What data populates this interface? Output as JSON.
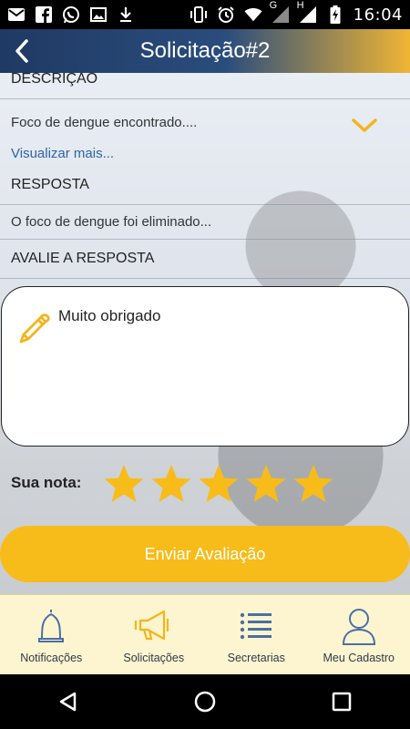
{
  "status_bar": {
    "time": "16:04",
    "left_icons": [
      "mail-icon",
      "facebook-icon",
      "whatsapp-icon",
      "image-icon",
      "download-icon"
    ],
    "right_icons": [
      "vibrate-icon",
      "alarm-icon",
      "wifi-icon",
      "g-signal-icon",
      "h-signal-icon",
      "battery-icon"
    ],
    "network_g": "G",
    "network_h": "H"
  },
  "app_bar": {
    "title": "Solicitação#2"
  },
  "sections": {
    "descricao_label": "DESCRIÇÃO",
    "descricao_text": "Foco de dengue encontrado....",
    "visualizar_mais": "Visualizar mais...",
    "resposta_label": "RESPOSTA",
    "resposta_text": "O foco de dengue foi eliminado...",
    "avalie_label": "AVALIE A RESPOSTA"
  },
  "review": {
    "comment_value": "Muito obrigado",
    "rating_label": "Sua nota:",
    "rating": 5,
    "max_rating": 5,
    "submit_label": "Enviar Avaliação"
  },
  "bottom_nav": {
    "items": [
      {
        "label": "Notificações",
        "icon": "bell-icon"
      },
      {
        "label": "Solicitações",
        "icon": "megaphone-icon"
      },
      {
        "label": "Secretarias",
        "icon": "list-icon"
      },
      {
        "label": "Meu Cadastro",
        "icon": "user-icon"
      }
    ]
  },
  "colors": {
    "accent": "#f7bc1a",
    "header_dark": "#1f3a63",
    "link": "#2e63a8",
    "nav_bg": "#fdf5cf"
  }
}
